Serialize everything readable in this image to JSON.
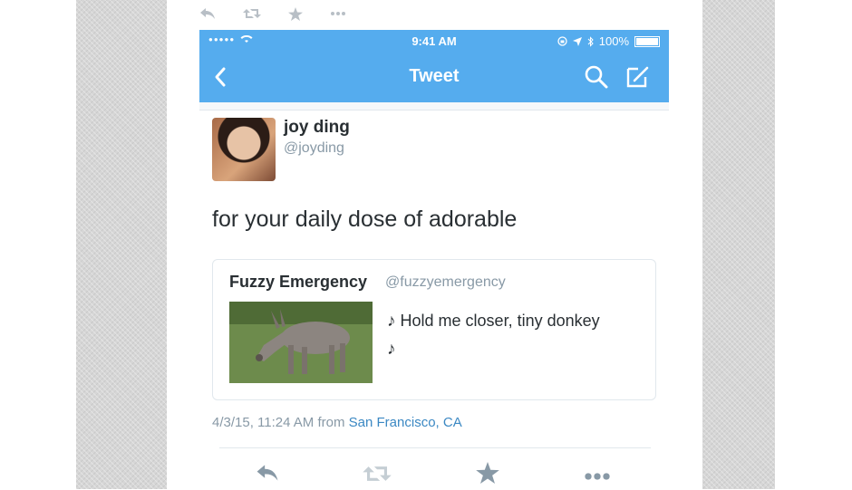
{
  "status_bar": {
    "time": "9:41 AM",
    "battery": "100%"
  },
  "nav": {
    "title": "Tweet"
  },
  "tweet": {
    "author_name": "joy ding",
    "author_handle": "@joyding",
    "text": "for your daily dose of adorable",
    "quoted": {
      "author_name": "Fuzzy Emergency",
      "author_handle": "@fuzzyemergency",
      "text_line1": "Hold me closer, tiny donkey",
      "note_symbol": "♪"
    },
    "timestamp": "4/3/15, 11:24 AM from",
    "location": "San Francisco, CA"
  },
  "icons": {
    "top_actions": [
      "reply-icon",
      "retweet-icon",
      "favorite-icon",
      "more-icon"
    ],
    "bottom_actions": [
      "reply-icon",
      "retweet-icon",
      "favorite-icon",
      "more-icon"
    ]
  },
  "colors": {
    "brand_blue": "#55acee",
    "link": "#3b88c3",
    "muted": "#8899a6",
    "text": "#292f33"
  }
}
